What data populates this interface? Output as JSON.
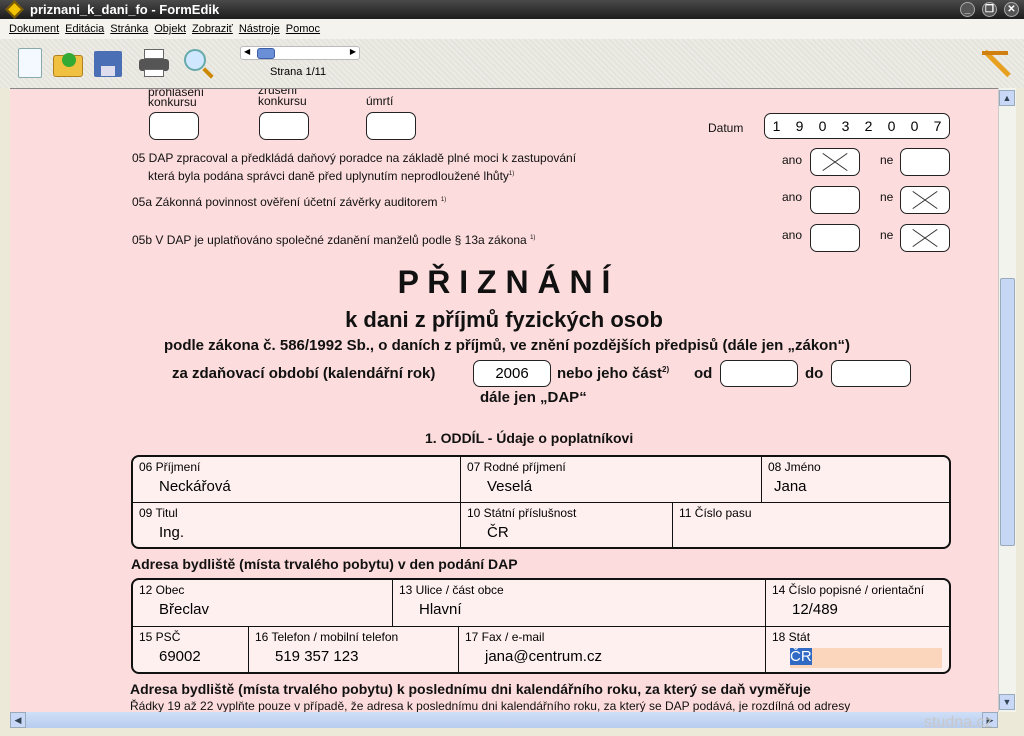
{
  "window": {
    "title": "priznani_k_dani_fo - FormEdik"
  },
  "menu": [
    "Dokument",
    "Editácia",
    "Stránka",
    "Objekt",
    "Zobraziť",
    "Nástroje",
    "Pomoc"
  ],
  "toolbar": {
    "page_label": "Strana 1/11"
  },
  "form": {
    "top_labels": [
      "prohlášení\nkonkursu",
      "zrušení\nkonkursu",
      "úmrtí"
    ],
    "top_label_line2": [
      "konkursu",
      "konkursu",
      "úmrtí"
    ],
    "top_label_line1": [
      "prohlášení",
      "zrušení"
    ],
    "datum_label": "Datum",
    "datum_digits": [
      "1",
      "9",
      "0",
      "3",
      "2",
      "0",
      "0",
      "7"
    ],
    "q05": "05 DAP zpracoval a předkládá daňový poradce na základě plné moci k zastupování",
    "q05_line2": "která byla podána správci daně před uplynutím neprodloužené lhůty",
    "q05a": "05a Zákonná povinnost ověření účetní závěrky auditorem",
    "q05b": "05b V DAP je uplatňováno společné zdanění manželů podle § 13a zákona",
    "footnote": "1)",
    "ano": "ano",
    "ne": "ne",
    "title": "P Ř I Z N Á N Í",
    "subtitle": "k dani z příjmů fyzických osob",
    "law": "podle zákona č. 586/1992 Sb., o daních z příjmů, ve znění pozdějších předpisů (dále jen „zákon“)",
    "period_label": "za zdaňovací období (kalendářní rok)",
    "year": "2006",
    "part_label": "nebo jeho část",
    "part_note": "2)",
    "od": "od",
    "do": "do",
    "dap": "dále jen „DAP“",
    "section1": "1. ODDÍL - Údaje o poplatníkovi",
    "fields1": [
      {
        "label": "06 Příjmení",
        "value": "Neckářová"
      },
      {
        "label": "07 Rodné příjmení",
        "value": "Veselá"
      },
      {
        "label": "08 Jméno",
        "value": "Jana"
      },
      {
        "label": "09 Titul",
        "value": "Ing."
      },
      {
        "label": "10 Státní příslušnost",
        "value": "ČR"
      },
      {
        "label": "11 Číslo pasu",
        "value": ""
      }
    ],
    "address_heading": "Adresa bydliště (místa trvalého pobytu) v den podání DAP",
    "fields2": [
      {
        "label": "12 Obec",
        "value": "Břeclav"
      },
      {
        "label": "13 Ulice / část obce",
        "value": "Hlavní"
      },
      {
        "label": "14 Číslo popisné / orientační",
        "value": "12/489"
      },
      {
        "label": "15 PSČ",
        "value": "69002"
      },
      {
        "label": "16 Telefon / mobilní telefon",
        "value": "519 357 123"
      },
      {
        "label": "17 Fax / e-mail",
        "value": "jana@centrum.cz"
      },
      {
        "label": "18 Stát",
        "value": "ČR"
      }
    ],
    "address2_heading": "Adresa bydliště (místa trvalého pobytu) k poslednímu dni kalendářního roku, za který se daň vyměřuje",
    "address2_note": "Řádky 19 až 22 vyplňte pouze v případě, že adresa k poslednímu dni kalendářního roku, za který se DAP podává, je rozdílná od adresy"
  },
  "watermark": "studna.cz"
}
